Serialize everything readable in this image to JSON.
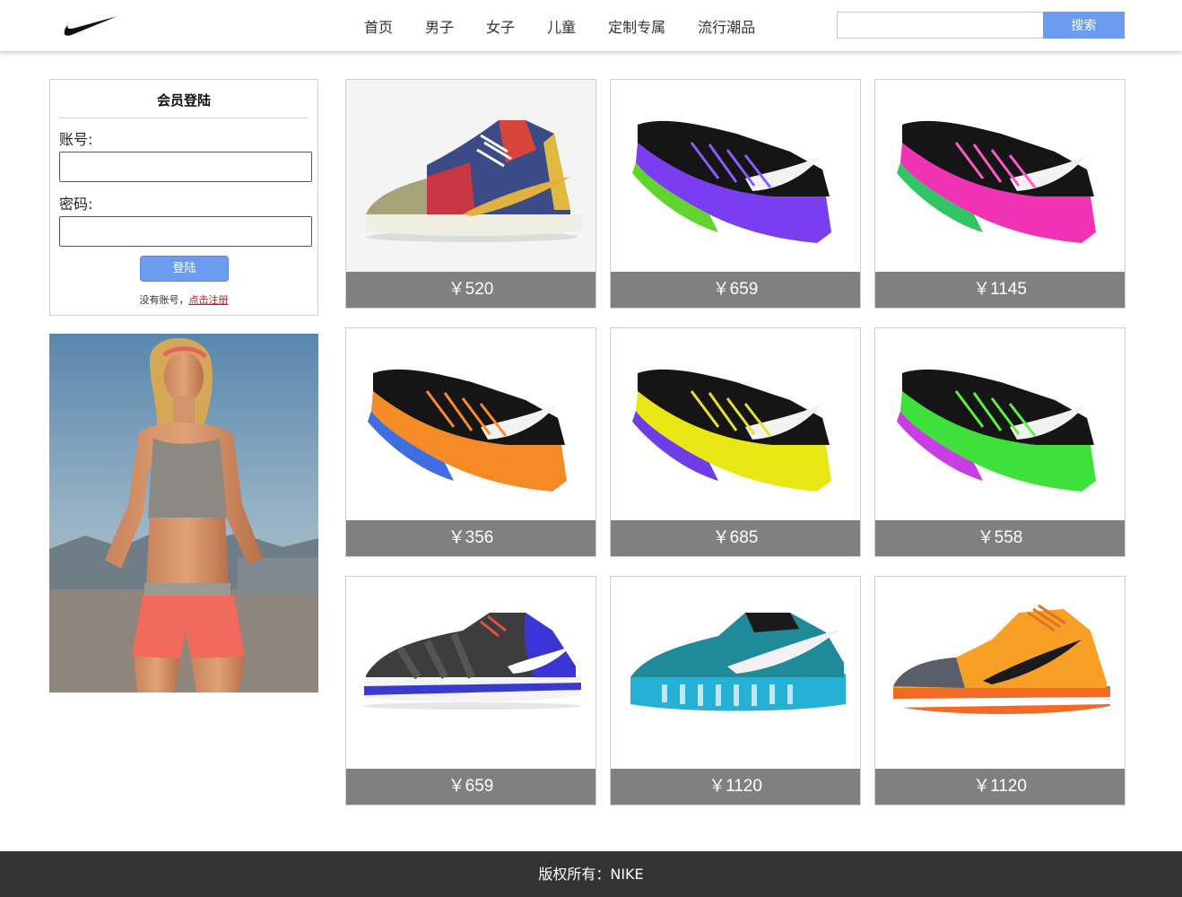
{
  "header": {
    "nav": [
      "首页",
      "男子",
      "女子",
      "儿童",
      "定制专属",
      "流行潮品"
    ],
    "search_button": "搜索",
    "brand_color": "#6c9cf0"
  },
  "login": {
    "title": "会员登陆",
    "account_label": "账号:",
    "password_label": "密码:",
    "button": "登陆",
    "register_prompt": "没有账号，",
    "register_link": "点击注册"
  },
  "products": [
    {
      "price": "￥520",
      "image": "blazer-mid-blue-yellow-sneaker"
    },
    {
      "price": "￥659",
      "image": "air-max-black-green-purple-sneaker"
    },
    {
      "price": "￥1145",
      "image": "air-max-black-green-pink-sneaker"
    },
    {
      "price": "￥356",
      "image": "air-max-black-blue-orange-sneaker"
    },
    {
      "price": "￥685",
      "image": "air-max-black-purple-yellow-sneaker"
    },
    {
      "price": "￥558",
      "image": "air-max-black-magenta-green-sneaker"
    },
    {
      "price": "￥659",
      "image": "free-trainer-grey-blue-sneaker"
    },
    {
      "price": "￥1120",
      "image": "flyknit-max-teal-sneaker"
    },
    {
      "price": "￥1120",
      "image": "kobe-orange-sneaker"
    }
  ],
  "footer": {
    "text": "版权所有：NIKE"
  }
}
